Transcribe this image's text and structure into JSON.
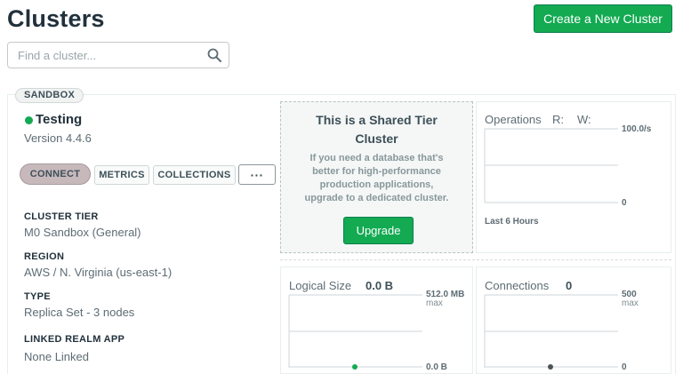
{
  "header": {
    "title": "Clusters",
    "create_button_label": "Create a New Cluster"
  },
  "search": {
    "placeholder": "Find a cluster...",
    "value": "",
    "icon": "search-icon"
  },
  "cluster": {
    "badge": "SANDBOX",
    "name": "Testing",
    "status_color": "#13aa52",
    "version": "Version 4.4.6",
    "actions": {
      "connect": "CONNECT",
      "metrics": "METRICS",
      "collections": "COLLECTIONS",
      "more": "···"
    },
    "details": [
      {
        "label": "CLUSTER TIER",
        "value": "M0 Sandbox (General)"
      },
      {
        "label": "REGION",
        "value": "AWS / N. Virginia (us-east-1)"
      },
      {
        "label": "TYPE",
        "value": "Replica Set - 3 nodes"
      },
      {
        "label": "LINKED REALM APP",
        "value": "None Linked"
      }
    ]
  },
  "shared_tier": {
    "title": "This is a Shared Tier Cluster",
    "description": "If you need a database that's better for high-performance production applications, upgrade to a dedicated cluster.",
    "upgrade_label": "Upgrade"
  },
  "metrics": {
    "operations": {
      "title": "Operations",
      "r_label": "R:",
      "w_label": "W:",
      "max_label": "100.0/s",
      "min_label": "0",
      "period": "Last 6 Hours"
    },
    "logical_size": {
      "title": "Logical Size",
      "value": "0.0 B",
      "max_label": "512.0 MB",
      "max_sub": "max",
      "min_label": "0.0 B"
    },
    "connections": {
      "title": "Connections",
      "value": "0",
      "max_label": "500",
      "max_sub": "max",
      "min_label": "0"
    }
  },
  "colors": {
    "accent_green": "#13aa52",
    "connect_highlight": "#c7b8bb"
  }
}
